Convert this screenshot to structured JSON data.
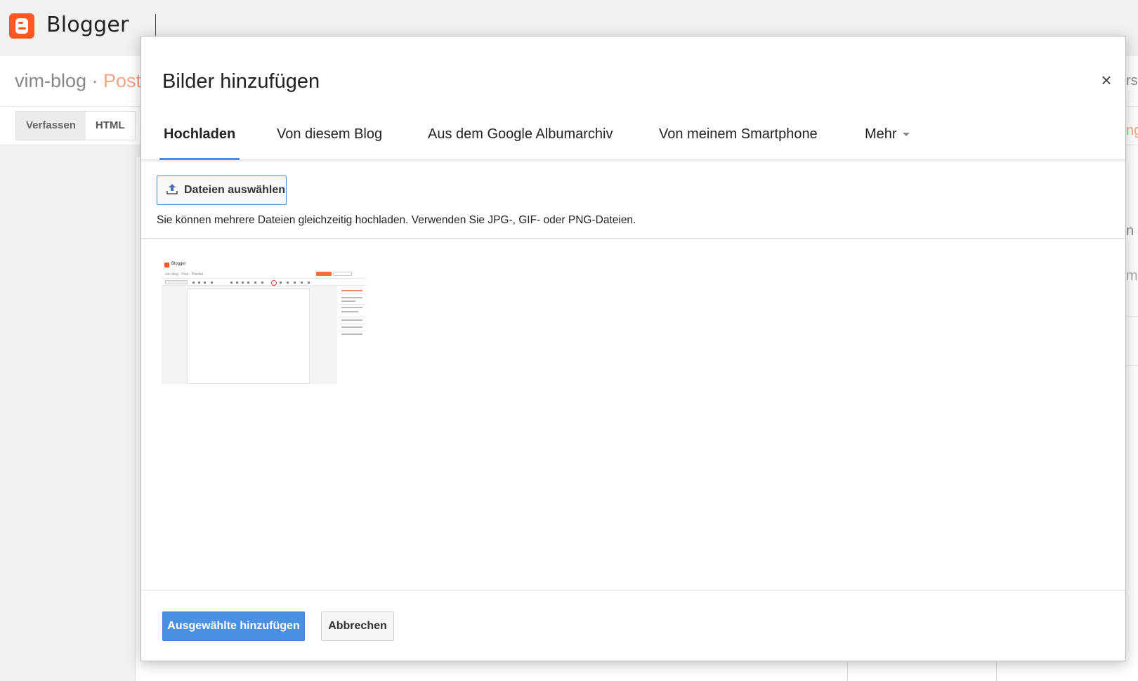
{
  "app": {
    "name": "Blogger"
  },
  "blog": {
    "name": "vim-blog ·",
    "section": "Post"
  },
  "editor_modes": [
    {
      "label": "Verfassen"
    },
    {
      "label": "HTML"
    }
  ],
  "peek": {
    "right_top": "rs",
    "right_tab": "ng",
    "right_mid1": "n",
    "right_mid2": "me"
  },
  "dialog": {
    "title": "Bilder hinzufügen",
    "close_glyph": "×",
    "tabs": [
      {
        "label": "Hochladen",
        "active": true
      },
      {
        "label": "Von diesem Blog"
      },
      {
        "label": "Aus dem Google Albumarchiv"
      },
      {
        "label": "Von meinem Smartphone"
      },
      {
        "label": "Mehr"
      }
    ],
    "choose_files_label": "Dateien auswählen",
    "choose_files_icon": "upload-icon",
    "upload_hint": "Sie können mehrere Dateien gleichzeitig hochladen. Verwenden Sie JPG-, GIF- oder PNG-Dateien.",
    "thumbnail": {
      "app_label": "Blogger",
      "blog_label": "vim-blog · Post · Postlist"
    },
    "add_selected_label": "Ausgewählte hinzufügen",
    "cancel_label": "Abbrechen"
  },
  "colors": {
    "accent": "#4a90e2",
    "brand": "#ff5722",
    "post_text": "#f0a487"
  }
}
